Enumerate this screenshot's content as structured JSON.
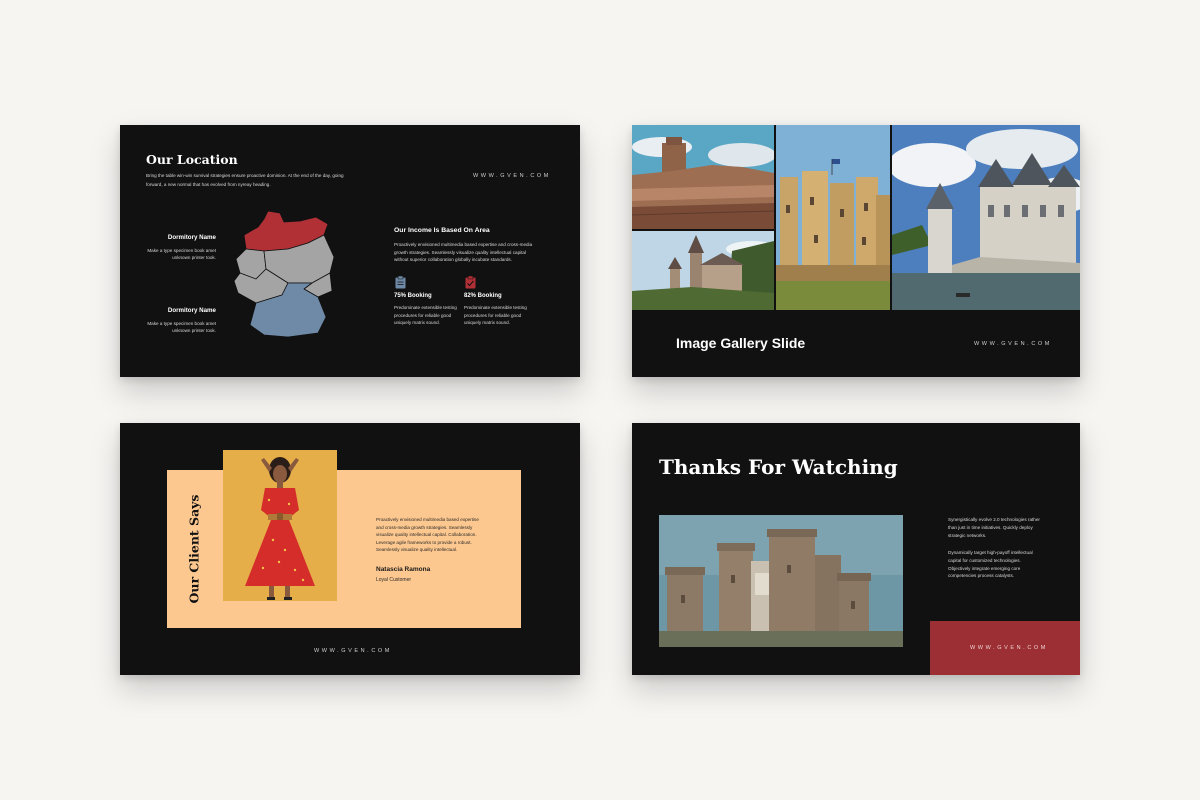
{
  "slide_location": {
    "title": "Our Location",
    "intro": "Bring the table win-win survival strategies ensure proactive dominion. At the end of the day, going forward, a new normal that has evolved from nyreay heading.",
    "site": "WWW.GVEN.COM",
    "dorm1": {
      "name": "Dormitory  Name",
      "desc": "Make a type specimen book amet unknown printer took."
    },
    "dorm2": {
      "name": "Dormitory  Name",
      "desc": "Make a type specimen book amet unknown printer took."
    },
    "income_title": "Our Income Is Based On Area",
    "income_text": "Proactively envisioned multimedia based expertise and cross-media growth strategies. Seamlessly visualize quality intellectual capital without superior collaboration globally incubate standards.",
    "stat1": {
      "label": "75% Booking",
      "percent": 75,
      "text": "Predominate extensible testing procedures for reliable good uniquely matrix sound."
    },
    "stat2": {
      "label": "82% Booking",
      "percent": 82,
      "text": "Predominate extensible testing procedures for reliable good uniquely matrix sound."
    },
    "colors": {
      "red": "#b03036",
      "blue": "#6f8aa6",
      "gray": "#a4a4a4"
    }
  },
  "slide_gallery": {
    "title": "Image Gallery Slide",
    "site": "WWW.GVEN.COM"
  },
  "slide_client": {
    "title": "Our Client Says",
    "quote": "Proactively envisioned multimedia based expertise and cross-media growth strategies. Seamlessly visualize quality intellectual capital. Collaboration. Leverage agile frameworks to provide a robust. Seamlessly visualize quality intellectual.",
    "name": "Natascia Ramona",
    "role": "Loyal Customer",
    "site": "WWW.GVEN.COM",
    "colors": {
      "panel": "#fdc88f",
      "photo_bg": "#e6ae49",
      "dress": "#d42d2a"
    }
  },
  "slide_thanks": {
    "title": "Thanks For Watching",
    "text1": "Synergistically evolve 2.0 technologies rather than just in time initiatives. Quickly deploy strategic networks.",
    "text2": "Dynamically target high-payoff intellectual capital for customized technologies. Objectively integrate emerging core competencies process catalysts.",
    "site": "WWW.GVEN.COM",
    "colors": {
      "accent": "#9c2f33"
    }
  }
}
